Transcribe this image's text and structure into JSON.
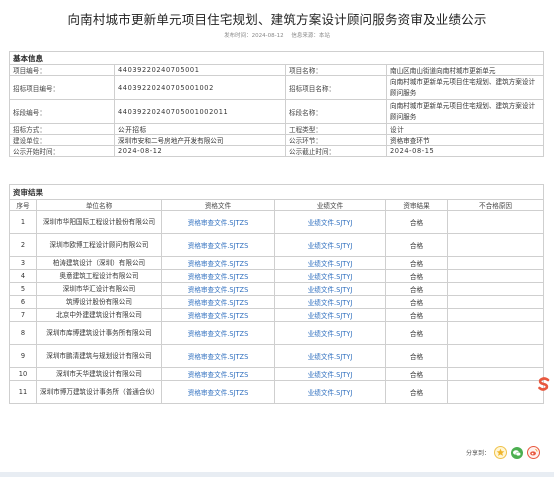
{
  "page": {
    "title": "向南村城市更新单元项目住宅规划、建筑方案设计顾问服务资审及业绩公示",
    "publish_label": "发布时间：",
    "publish_date": "2024-08-12",
    "source_label": "信息来源：",
    "source": "本站"
  },
  "info": {
    "section_title": "基本信息",
    "rows": [
      {
        "l1": "项目编号：",
        "v1": "44039220240705001",
        "l2": "项目名称：",
        "v2": "南山区南山街道向南村城市更新单元"
      },
      {
        "l1": "招标项目编号：",
        "v1": "44039220240705001002",
        "l2": "招标项目名称：",
        "v2": "向南村城市更新单元项目住宅规划、建筑方案设计顾问服务"
      },
      {
        "l1": "标段编号：",
        "v1": "44039220240705001002011",
        "l2": "标段名称：",
        "v2": "向南村城市更新单元项目住宅规划、建筑方案设计顾问服务"
      },
      {
        "l1": "招标方式：",
        "v1": "公开招标",
        "l2": "工程类型：",
        "v2": "设计"
      },
      {
        "l1": "建设单位：",
        "v1": "深圳市安和二号房地产开发有限公司",
        "l2": "公示环节：",
        "v2": "资格审查环节"
      },
      {
        "l1": "公示开始时间：",
        "v1": "2024-08-12",
        "l2": "公示截止时间：",
        "v2": "2024-08-15"
      }
    ]
  },
  "results": {
    "section_title": "资审结果",
    "headers": [
      "序号",
      "单位名称",
      "资格文件",
      "业绩文件",
      "资审结果",
      "不合格原因"
    ],
    "rows": [
      {
        "no": "1",
        "unit": "深圳市华阳国际工程设计股份有限公司",
        "qual": "资格审查文件.SJTZS",
        "perf": "业绩文件.SJTYJ",
        "result": "合格",
        "reason": ""
      },
      {
        "no": "2",
        "unit": "深圳市欧博工程设计顾问有限公司",
        "qual": "资格审查文件.SJTZS",
        "perf": "业绩文件.SJTYJ",
        "result": "合格",
        "reason": ""
      },
      {
        "no": "3",
        "unit": "柏涛建筑设计（深圳）有限公司",
        "qual": "资格审查文件.SJTZS",
        "perf": "业绩文件.SJTYJ",
        "result": "合格",
        "reason": ""
      },
      {
        "no": "4",
        "unit": "奥意建筑工程设计有限公司",
        "qual": "资格审查文件.SJTZS",
        "perf": "业绩文件.SJTYJ",
        "result": "合格",
        "reason": ""
      },
      {
        "no": "5",
        "unit": "深圳市华汇设计有限公司",
        "qual": "资格审查文件.SJTZS",
        "perf": "业绩文件.SJTYJ",
        "result": "合格",
        "reason": ""
      },
      {
        "no": "6",
        "unit": "筑博设计股份有限公司",
        "qual": "资格审查文件.SJTZS",
        "perf": "业绩文件.SJTYJ",
        "result": "合格",
        "reason": ""
      },
      {
        "no": "7",
        "unit": "北京中外建建筑设计有限公司",
        "qual": "资格审查文件.SJTZS",
        "perf": "业绩文件.SJTYJ",
        "result": "合格",
        "reason": ""
      },
      {
        "no": "8",
        "unit": "深圳市库博建筑设计事务所有限公司",
        "qual": "资格审查文件.SJTZS",
        "perf": "业绩文件.SJTYJ",
        "result": "合格",
        "reason": ""
      },
      {
        "no": "9",
        "unit": "深圳市鹏清建筑与规划设计有限公司",
        "qual": "资格审查文件.SJTZS",
        "perf": "业绩文件.SJTYJ",
        "result": "合格",
        "reason": ""
      },
      {
        "no": "10",
        "unit": "深圳市天华建筑设计有限公司",
        "qual": "资格审查文件.SJTZS",
        "perf": "业绩文件.SJTYJ",
        "result": "合格",
        "reason": ""
      },
      {
        "no": "11",
        "unit": "深圳市博万建筑设计事务所（普通合伙）",
        "qual": "资格审查文件.SJTZS",
        "perf": "业绩文件.SJTYJ",
        "result": "合格",
        "reason": ""
      }
    ]
  },
  "share": {
    "label": "分享到："
  },
  "icons": {
    "share_1": "qzone-star-icon",
    "share_2": "wechat-icon",
    "share_3": "weibo-icon",
    "floating": "sogou-s-icon"
  },
  "colors": {
    "link": "#2f6fbf",
    "border": "#cfcfcf"
  }
}
